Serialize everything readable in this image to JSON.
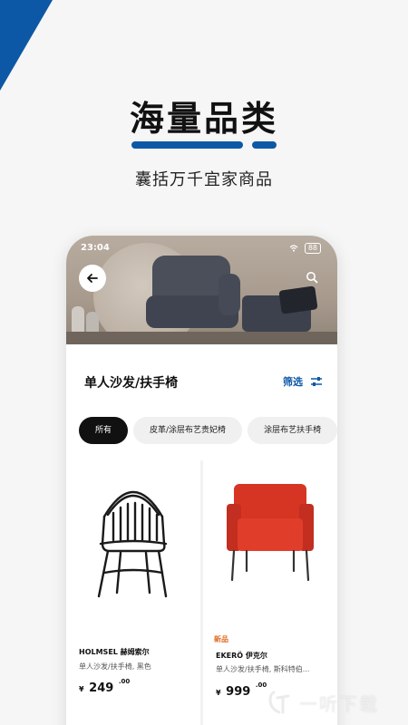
{
  "promo": {
    "title": "海量品类",
    "subtitle": "囊括万千宜家商品",
    "accent_color": "#0d58a6"
  },
  "status_bar": {
    "time": "23:04",
    "signal_icon": "signal-icon",
    "wifi_icon": "wifi-icon",
    "battery": "88"
  },
  "header": {
    "back_icon": "arrow-left-icon",
    "search_icon": "search-icon"
  },
  "category": {
    "title": "单人沙发/扶手椅",
    "filter_label": "筛选",
    "filter_icon": "sliders-icon"
  },
  "chips": [
    {
      "label": "所有",
      "active": true
    },
    {
      "label": "皮革/涂层布艺贵妃椅",
      "active": false
    },
    {
      "label": "涂层布艺扶手椅",
      "active": false
    }
  ],
  "products": [
    {
      "badge": "",
      "name": "HOLMSEL 赫姆索尔",
      "desc": "单人沙发/扶手椅, 黑色",
      "currency": "¥",
      "price_int": "249",
      "price_dec": ".00"
    },
    {
      "badge": "新品",
      "name": "EKERÖ 伊克尔",
      "desc": "单人沙发/扶手椅, 斯科特伯...",
      "currency": "¥",
      "price_int": "999",
      "price_dec": ".00"
    }
  ],
  "watermark": {
    "text": "一听下载",
    "icon": "listen-logo-icon"
  }
}
